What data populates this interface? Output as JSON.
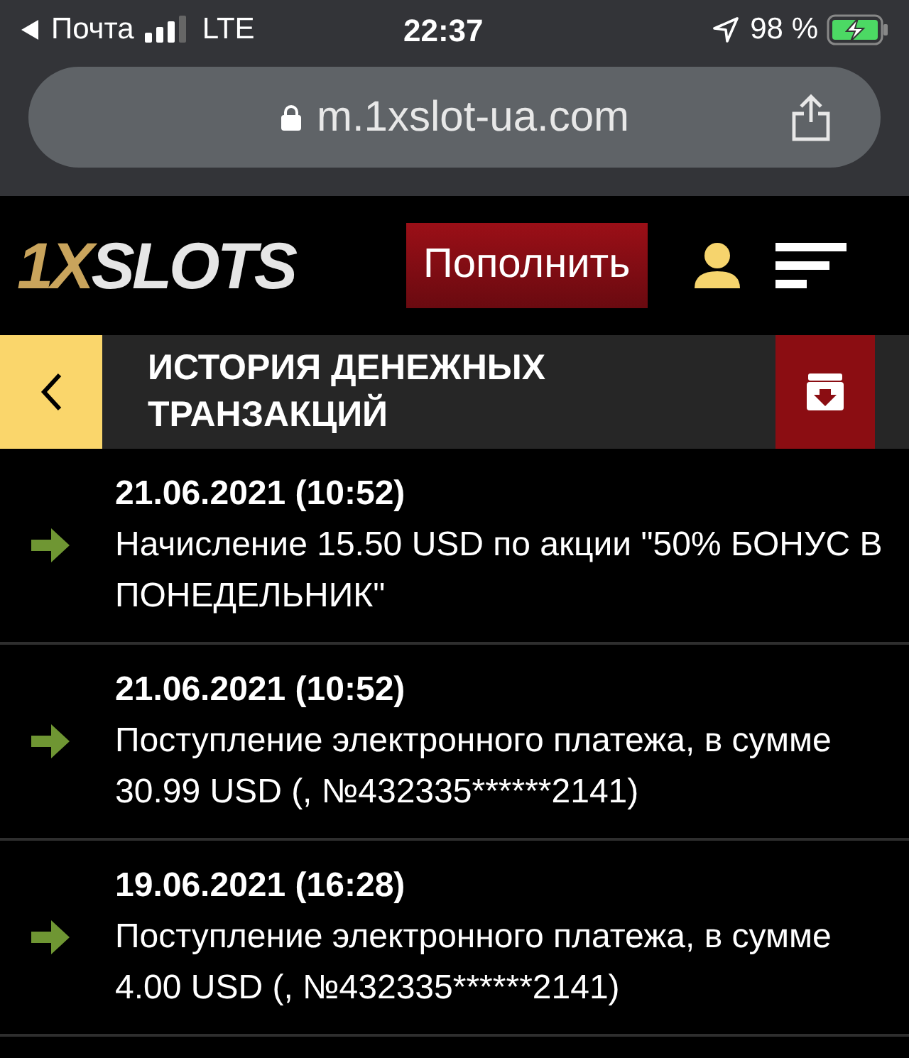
{
  "status_bar": {
    "back_app": "Почта",
    "network": "LTE",
    "time": "22:37",
    "battery": "98 %"
  },
  "address_bar": {
    "url": "m.1xslot-ua.com"
  },
  "header": {
    "logo": {
      "prefix": "1X",
      "name": "SLOTS"
    },
    "deposit_button": "Пополнить"
  },
  "title": "ИСТОРИЯ ДЕНЕЖНЫХ ТРАНЗАКЦИЙ",
  "transactions": [
    {
      "date": "21.06.2021 (10:52)",
      "description": "Начисление 15.50 USD по акции \"50% БОНУС В ПОНЕДЕЛЬНИК\""
    },
    {
      "date": "21.06.2021 (10:52)",
      "description": "Поступление электронного платежа, в сумме 30.99 USD (, №432335******2141)"
    },
    {
      "date": "19.06.2021 (16:28)",
      "description": "Поступление электронного платежа, в сумме 4.00 USD (, №432335******2141)"
    }
  ]
}
